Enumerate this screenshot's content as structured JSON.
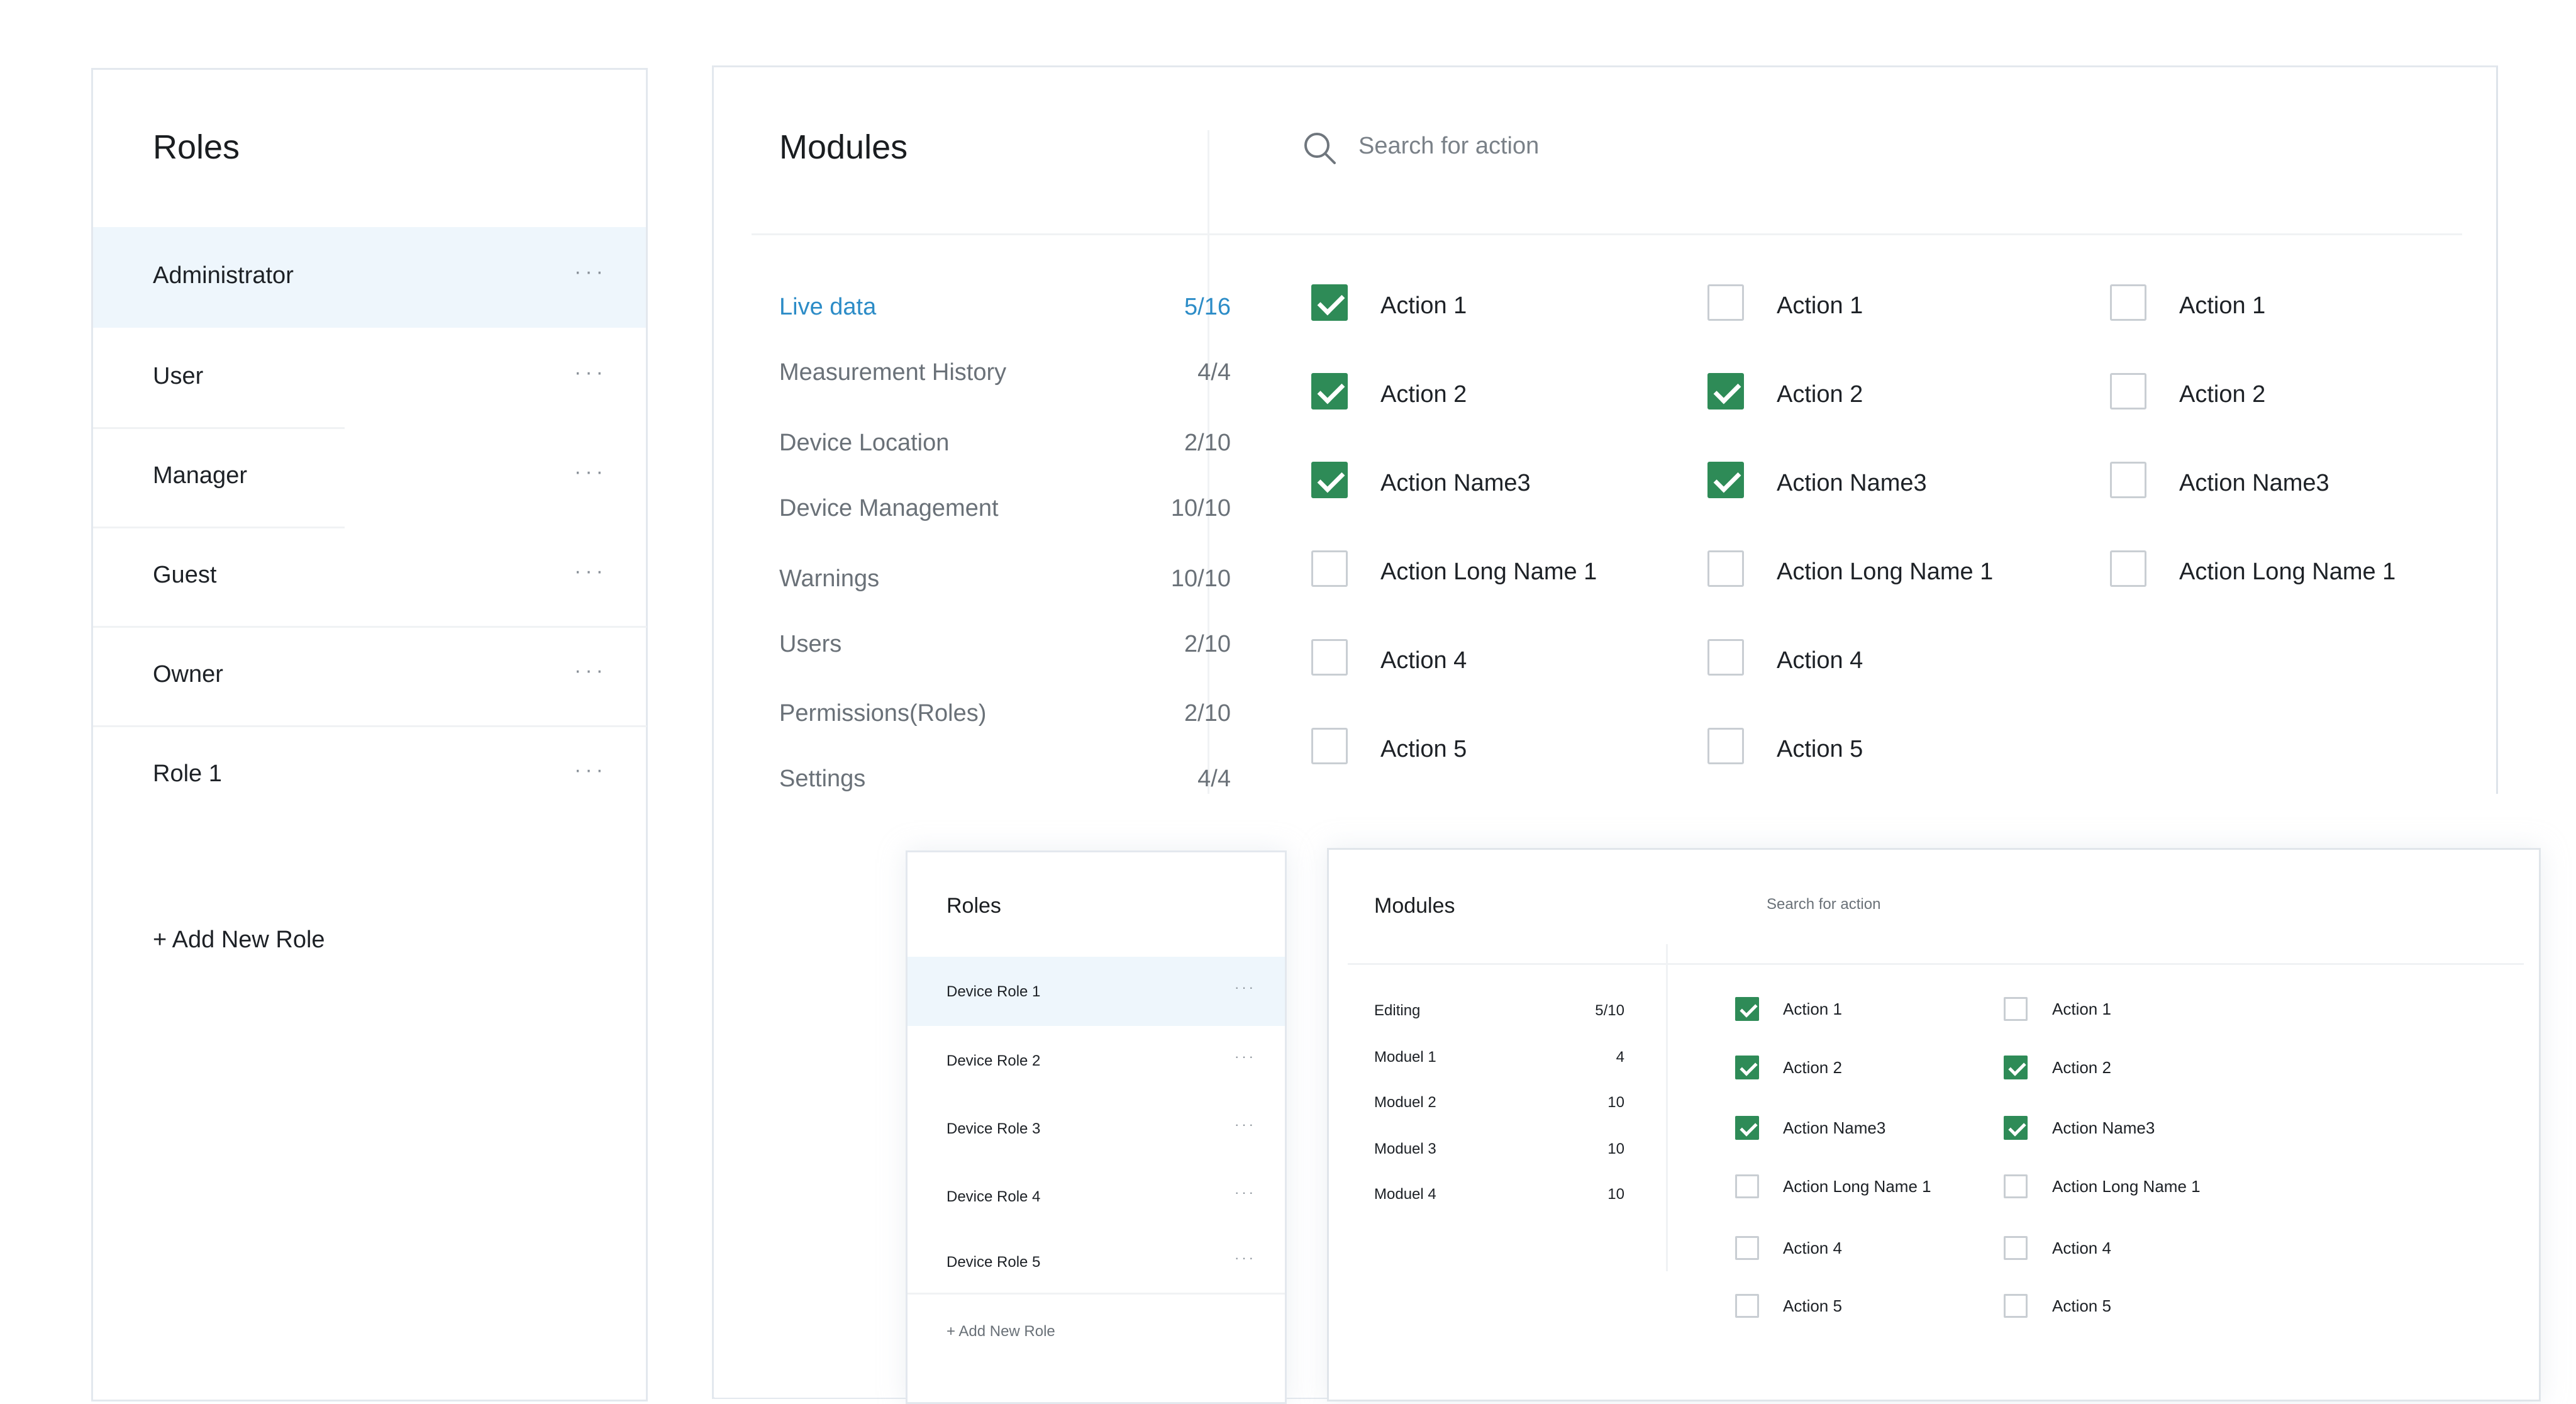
{
  "roles_panel": {
    "title": "Roles",
    "items": [
      {
        "label": "Administrator",
        "selected": true
      },
      {
        "label": "User",
        "selected": false
      },
      {
        "label": "Manager",
        "selected": false
      },
      {
        "label": "Guest",
        "selected": false
      },
      {
        "label": "Owner",
        "selected": false
      },
      {
        "label": "Role 1",
        "selected": false
      }
    ],
    "more_glyph": "···",
    "add_label": "+ Add New Role"
  },
  "modules_panel": {
    "title": "Modules",
    "search": {
      "placeholder": "Search for action",
      "icon": "search-icon"
    },
    "modules": [
      {
        "name": "Live data",
        "count": "5/16",
        "active": true
      },
      {
        "name": "Measurement History",
        "count": "4/4",
        "active": false
      },
      {
        "name": "Device Location",
        "count": "2/10",
        "active": false
      },
      {
        "name": "Device Management",
        "count": "10/10",
        "active": false
      },
      {
        "name": "Warnings",
        "count": "10/10",
        "active": false
      },
      {
        "name": "Users",
        "count": "2/10",
        "active": false
      },
      {
        "name": "Permissions(Roles)",
        "count": "2/10",
        "active": false
      },
      {
        "name": "Settings",
        "count": "4/4",
        "active": false
      }
    ],
    "action_columns": [
      [
        {
          "label": "Action 1",
          "checked": true
        },
        {
          "label": "Action 2",
          "checked": true
        },
        {
          "label": "Action Name3",
          "checked": true
        },
        {
          "label": "Action Long Name 1",
          "checked": false
        },
        {
          "label": "Action 4",
          "checked": false
        },
        {
          "label": "Action 5",
          "checked": false
        }
      ],
      [
        {
          "label": "Action 1",
          "checked": false
        },
        {
          "label": "Action 2",
          "checked": true
        },
        {
          "label": "Action Name3",
          "checked": true
        },
        {
          "label": "Action Long Name 1",
          "checked": false
        },
        {
          "label": "Action 4",
          "checked": false
        },
        {
          "label": "Action 5",
          "checked": false
        }
      ],
      [
        {
          "label": "Action 1",
          "checked": false
        },
        {
          "label": "Action 2",
          "checked": false
        },
        {
          "label": "Action Name3",
          "checked": false
        },
        {
          "label": "Action Long Name 1",
          "checked": false
        }
      ]
    ]
  },
  "overlay_roles": {
    "title": "Roles",
    "items": [
      {
        "label": "Device Role 1",
        "selected": true
      },
      {
        "label": "Device Role 2",
        "selected": false
      },
      {
        "label": "Device Role 3",
        "selected": false
      },
      {
        "label": "Device Role 4",
        "selected": false
      },
      {
        "label": "Device Role 5",
        "selected": false
      }
    ],
    "more_glyph": "···",
    "add_label": "+ Add New Role"
  },
  "overlay_modules": {
    "title": "Modules",
    "search_placeholder": "Search for action",
    "modules": [
      {
        "name": "Editing",
        "count": "5/10",
        "active": true
      },
      {
        "name": "Moduel 1",
        "count": "4",
        "active": false
      },
      {
        "name": "Moduel 2",
        "count": "10",
        "active": false
      },
      {
        "name": "Moduel 3",
        "count": "10",
        "active": false
      },
      {
        "name": "Moduel 4",
        "count": "10",
        "active": false
      }
    ],
    "action_columns": [
      [
        {
          "label": "Action 1",
          "checked": true
        },
        {
          "label": "Action 2",
          "checked": true
        },
        {
          "label": "Action Name3",
          "checked": true
        },
        {
          "label": "Action Long Name 1",
          "checked": false
        },
        {
          "label": "Action 4",
          "checked": false
        },
        {
          "label": "Action 5",
          "checked": false
        }
      ],
      [
        {
          "label": "Action 1",
          "checked": false
        },
        {
          "label": "Action 2",
          "checked": true
        },
        {
          "label": "Action Name3",
          "checked": true
        },
        {
          "label": "Action Long Name 1",
          "checked": false
        },
        {
          "label": "Action 4",
          "checked": false
        },
        {
          "label": "Action 5",
          "checked": false
        }
      ]
    ]
  },
  "colors": {
    "accent_blue": "#2c8cc7",
    "check_green": "#2e8b57",
    "selected_bg": "#eef6fc"
  }
}
